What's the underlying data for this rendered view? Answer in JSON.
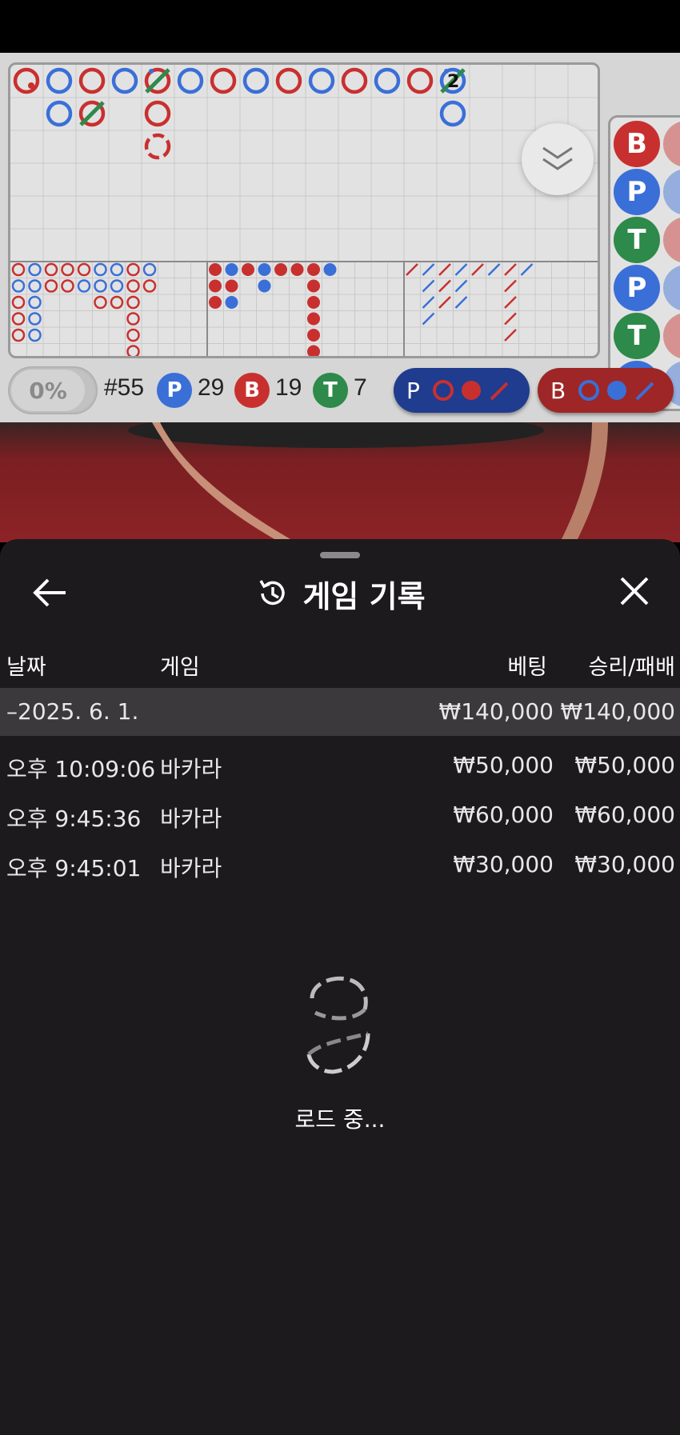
{
  "scoreboard": {
    "percent_label": "0%",
    "round_label": "#55",
    "player_badge": "P",
    "player_count": "29",
    "banker_badge": "B",
    "banker_count": "19",
    "tie_badge": "T",
    "tie_count": "7",
    "streak_number": "2",
    "predict_player_label": "P",
    "predict_banker_label": "B",
    "side_badges": [
      "B",
      "P",
      "T",
      "P",
      "T",
      "P"
    ],
    "colors": {
      "player": "#3a6fd8",
      "banker": "#c8302f",
      "tie": "#2d8a4a"
    }
  },
  "sheet": {
    "title": "게임 기록",
    "headers": {
      "date": "날짜",
      "game": "게임",
      "bet": "베팅",
      "winloss": "승리/패배"
    },
    "date_row": {
      "date": "–2025. 6. 1.",
      "bet": "₩140,000",
      "winloss": "₩140,000"
    },
    "rows": [
      {
        "time": "오후 10:09:06",
        "game": "바카라",
        "bet": "₩50,000",
        "winloss": "₩50,000"
      },
      {
        "time": "오후 9:45:36",
        "game": "바카라",
        "bet": "₩60,000",
        "winloss": "₩60,000"
      },
      {
        "time": "오후 9:45:01",
        "game": "바카라",
        "bet": "₩30,000",
        "winloss": "₩30,000"
      }
    ],
    "loading_text": "로드 중..."
  },
  "icons": {
    "back": "arrow-left-icon",
    "history": "history-icon",
    "close": "close-icon",
    "collapse": "double-chevron-down-icon",
    "loader": "spinner-icon"
  }
}
